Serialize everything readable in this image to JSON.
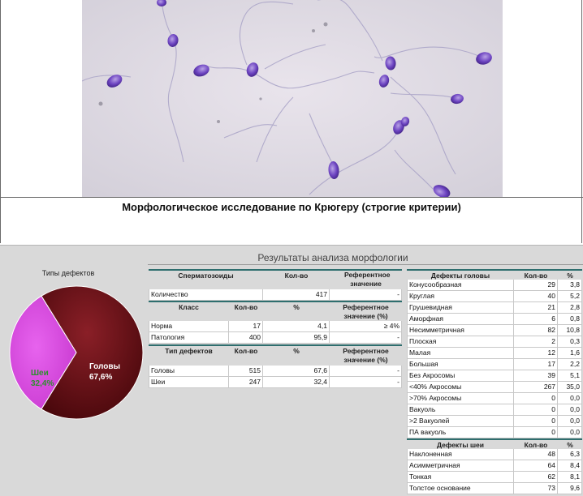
{
  "heading": "Морфологическое исследование по Крюгеру (строгие критерии)",
  "report": {
    "title": "Результаты анализа морфологии",
    "pie": {
      "title": "Типы дефектов",
      "slices": [
        {
          "label": "Головы",
          "value_text": "67,6%",
          "value": 67.6,
          "color": "#6b0f14"
        },
        {
          "label": "Шеи",
          "value_text": "32,4%",
          "value": 32.4,
          "color": "#d743de"
        }
      ]
    },
    "sperm": {
      "headers": [
        "Сперматозоиды",
        "Кол-во",
        "Референтное значение"
      ],
      "rows": [
        {
          "label": "Количество",
          "count": "417",
          "ref": "-"
        }
      ]
    },
    "classes": {
      "headers": [
        "Класс",
        "Кол-во",
        "%",
        "Референтное значение (%)"
      ],
      "rows": [
        {
          "label": "Норма",
          "count": "17",
          "pct": "4,1",
          "ref": "≥ 4%"
        },
        {
          "label": "Патология",
          "count": "400",
          "pct": "95,9",
          "ref": "-"
        }
      ]
    },
    "defect_types": {
      "headers": [
        "Тип дефектов",
        "Кол-во",
        "%",
        "Референтное значение (%)"
      ],
      "rows": [
        {
          "label": "Головы",
          "count": "515",
          "pct": "67,6",
          "ref": "-"
        },
        {
          "label": "Шеи",
          "count": "247",
          "pct": "32,4",
          "ref": "-"
        }
      ]
    },
    "head_defects": {
      "headers": [
        "Дефекты головы",
        "Кол-во",
        "%"
      ],
      "rows": [
        {
          "label": "Конусообразная",
          "count": "29",
          "pct": "3,8"
        },
        {
          "label": "Круглая",
          "count": "40",
          "pct": "5,2"
        },
        {
          "label": "Грушевидная",
          "count": "21",
          "pct": "2,8"
        },
        {
          "label": "Аморфная",
          "count": "6",
          "pct": "0,8"
        },
        {
          "label": "Несимметричная",
          "count": "82",
          "pct": "10,8"
        },
        {
          "label": "Плоская",
          "count": "2",
          "pct": "0,3"
        },
        {
          "label": "Малая",
          "count": "12",
          "pct": "1,6"
        },
        {
          "label": "Большая",
          "count": "17",
          "pct": "2,2"
        },
        {
          "label": "Без Акросомы",
          "count": "39",
          "pct": "5,1"
        },
        {
          "label": "<40% Акросомы",
          "count": "267",
          "pct": "35,0"
        },
        {
          "label": ">70% Акросомы",
          "count": "0",
          "pct": "0,0"
        },
        {
          "label": "Вакуоль",
          "count": "0",
          "pct": "0,0"
        },
        {
          "label": ">2 Вакуолей",
          "count": "0",
          "pct": "0,0"
        },
        {
          "label": "ПА вакуоль",
          "count": "0",
          "pct": "0,0"
        }
      ]
    },
    "neck_defects": {
      "headers": [
        "Дефекты шеи",
        "Кол-во",
        "%"
      ],
      "rows": [
        {
          "label": "Наклоненная",
          "count": "48",
          "pct": "6,3"
        },
        {
          "label": "Асимметричная",
          "count": "64",
          "pct": "8,4"
        },
        {
          "label": "Тонкая",
          "count": "62",
          "pct": "8,1"
        },
        {
          "label": "Толстое основание",
          "count": "73",
          "pct": "9,6"
        }
      ]
    }
  }
}
